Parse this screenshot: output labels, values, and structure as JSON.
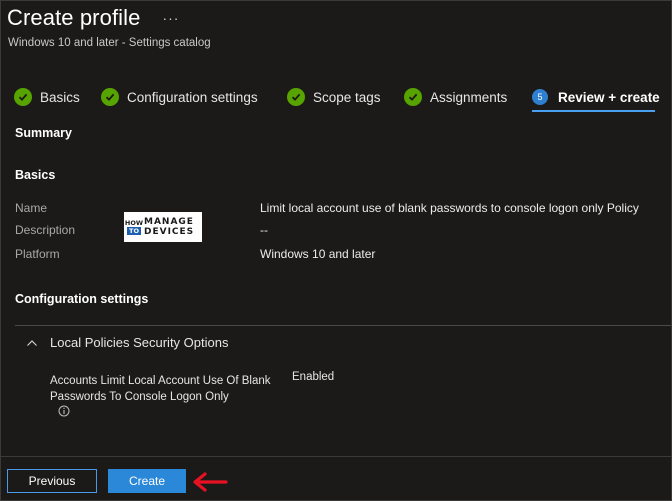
{
  "header": {
    "title": "Create profile",
    "more": "···",
    "subtitle": "Windows 10 and later - Settings catalog"
  },
  "steps": [
    {
      "label": "Basics",
      "state": "complete"
    },
    {
      "label": "Configuration settings",
      "state": "complete"
    },
    {
      "label": "Scope tags",
      "state": "complete"
    },
    {
      "label": "Assignments",
      "state": "complete"
    },
    {
      "label": "Review + create",
      "state": "active",
      "number": "5"
    }
  ],
  "summary": {
    "heading": "Summary",
    "basics_heading": "Basics",
    "fields": [
      {
        "label": "Name",
        "value": "Limit local account use of blank  passwords to console logon only Policy"
      },
      {
        "label": "Description",
        "value": "--"
      },
      {
        "label": "Platform",
        "value": "Windows 10 and later"
      }
    ]
  },
  "logo": {
    "how": "HOW",
    "to": "TO",
    "manage": "MANAGE",
    "devices": "DEVICES"
  },
  "config": {
    "heading": "Configuration settings",
    "group_title": "Local Policies Security Options",
    "setting_name": "Accounts Limit Local Account Use Of Blank Passwords To Console Logon Only",
    "setting_value": "Enabled"
  },
  "footer": {
    "previous_label": "Previous",
    "create_label": "Create"
  },
  "colors": {
    "background": "#1b1a19",
    "success": "#57a300",
    "accent": "#2b88d8",
    "annotation_arrow": "#e81123"
  }
}
